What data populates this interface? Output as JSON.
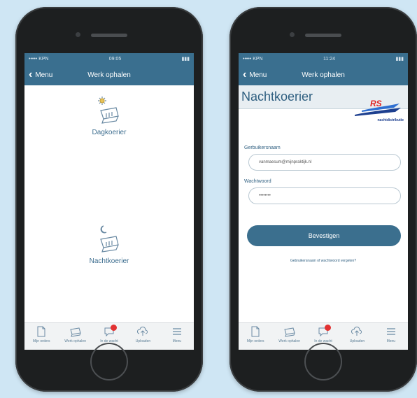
{
  "status_bar": {
    "carrier": "••••• KPN",
    "time_left": "09:05",
    "time_right": "11:24",
    "battery": "▮▮▮"
  },
  "left_phone": {
    "nav": {
      "back_label": "Menu",
      "title": "Werk ophalen"
    },
    "choices": [
      {
        "label": "Dagkoerier",
        "icon": "sun-parcel-icon"
      },
      {
        "label": "Nachtkoerier",
        "icon": "moon-parcel-icon"
      }
    ]
  },
  "right_phone": {
    "nav": {
      "back_label": "Menu",
      "title": "Werk ophalen"
    },
    "header_title": "Nachtkoerier",
    "logo": {
      "letters": "RS",
      "tagline": "nachtdistributie"
    },
    "username": {
      "label": "Gerbuikersnaam",
      "value": "vanmaesum@mijnpraktijk.nl"
    },
    "password": {
      "label": "Wachtwoord",
      "value": "••••••••"
    },
    "confirm_button": "Bevestigen",
    "forgot_link": "Gebruikersnaam of wachtwoord vergeten?"
  },
  "tabbar": [
    {
      "label": "Mijn orders",
      "icon": "document-icon"
    },
    {
      "label": "Werk ophalen",
      "icon": "parcel-icon"
    },
    {
      "label": "In de wacht",
      "icon": "chat-icon",
      "badge": true
    },
    {
      "label": "Uploaden",
      "icon": "cloud-upload-icon"
    },
    {
      "label": "Menu",
      "icon": "menu-icon"
    }
  ],
  "colors": {
    "nav_bar": "#3a6f8f",
    "accent": "#3b6f8e",
    "badge": "#e23232",
    "background": "#cfe6f4"
  }
}
